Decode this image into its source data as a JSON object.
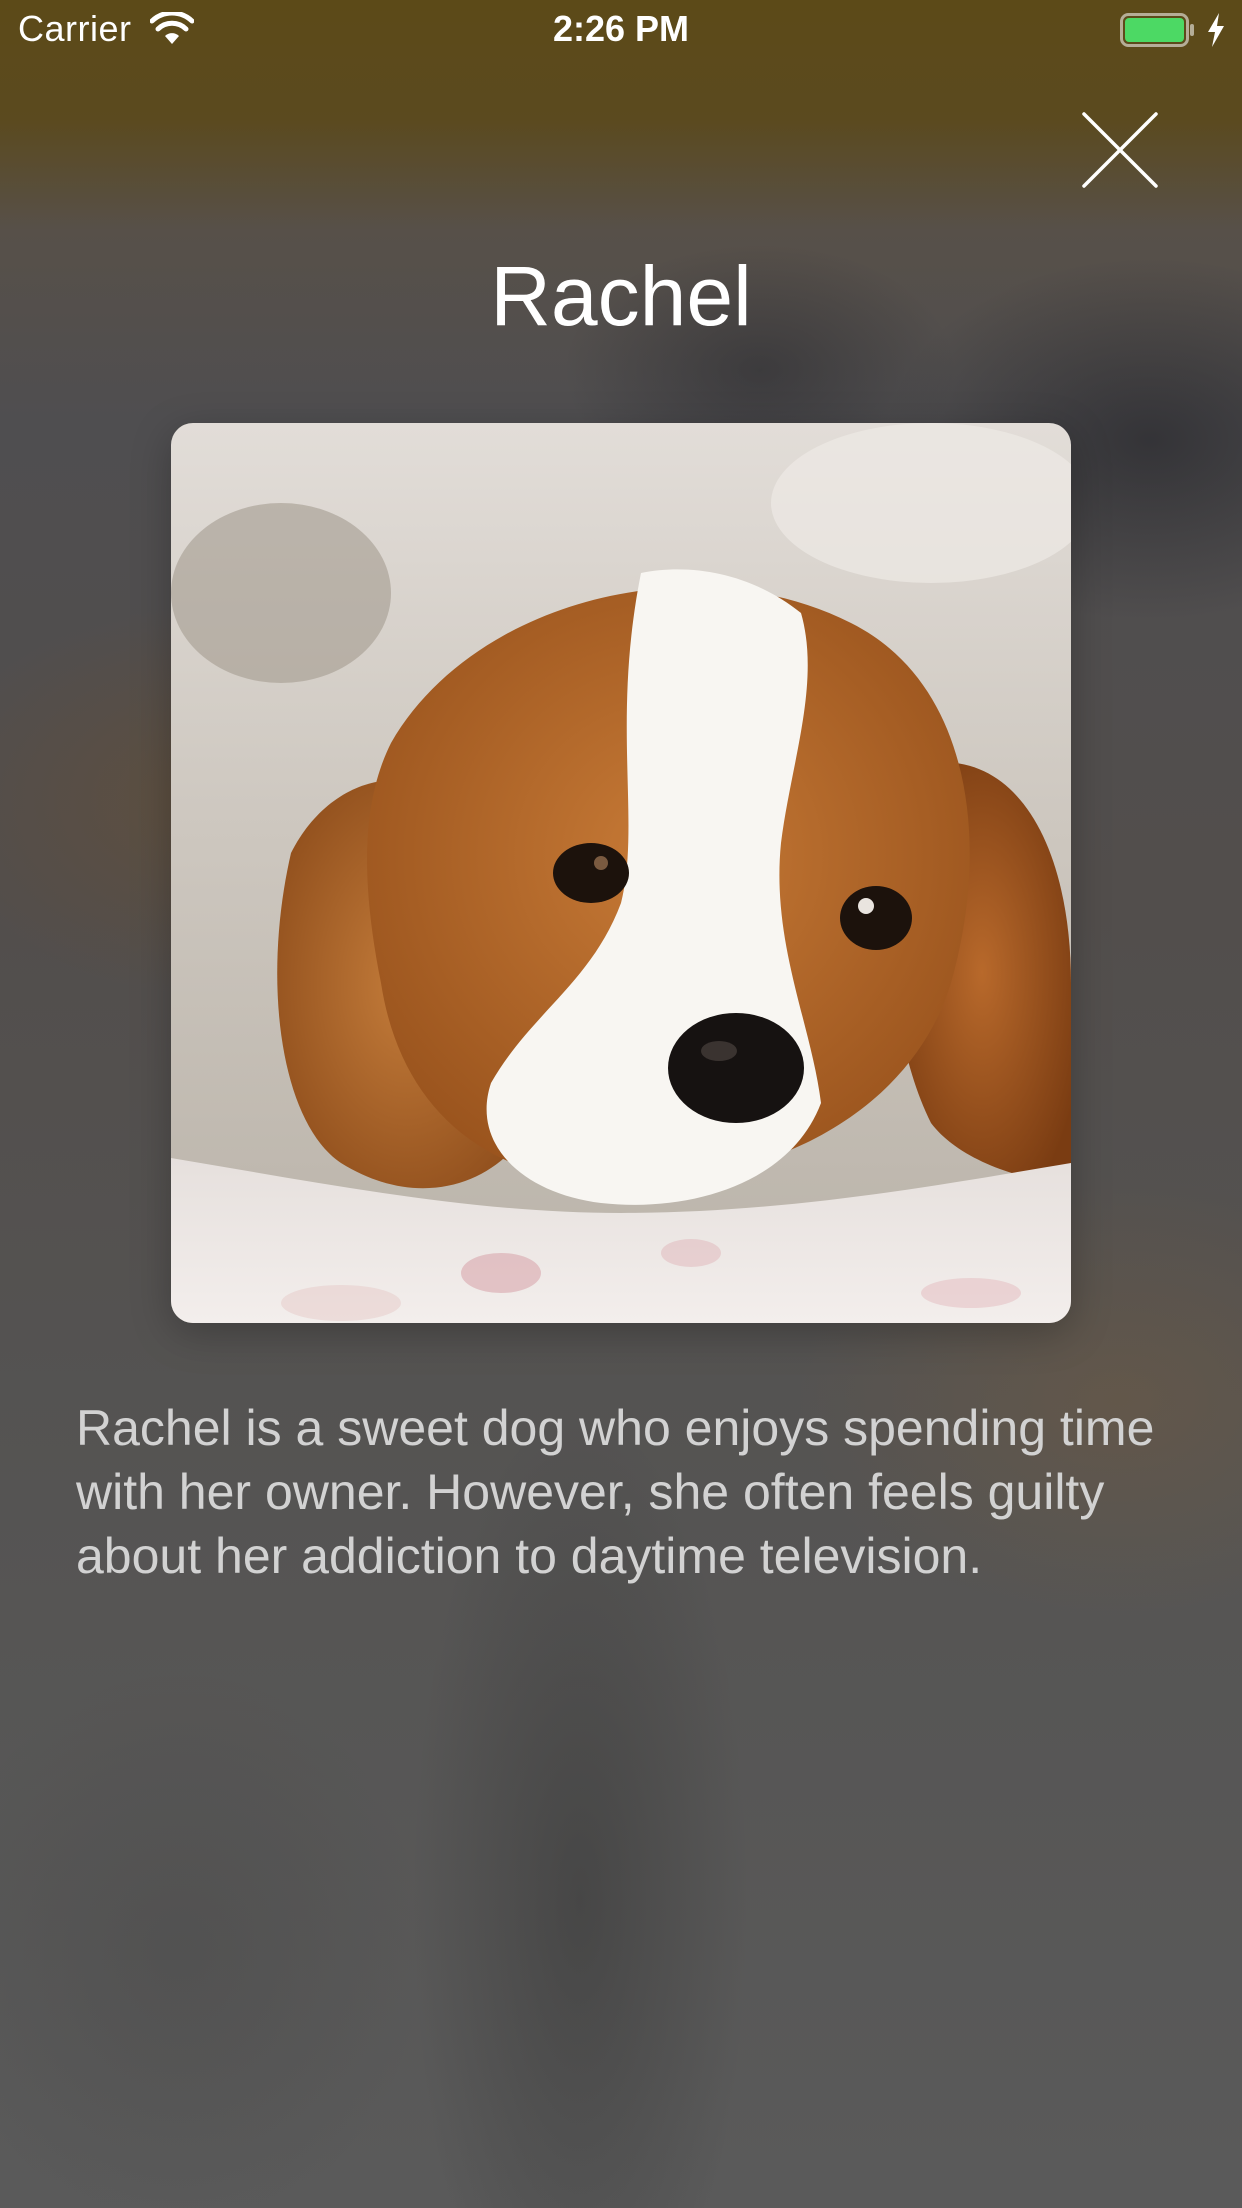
{
  "status_bar": {
    "carrier": "Carrier",
    "time": "2:26 PM",
    "battery_color": "#4cd964"
  },
  "close_button": {
    "icon": "close-icon"
  },
  "pet": {
    "name": "Rachel",
    "photo_subject": "dog-photo",
    "description": "Rachel is a sweet dog who enjoys spending time with her owner. However, she often feels guilty about her addiction to daytime television."
  }
}
